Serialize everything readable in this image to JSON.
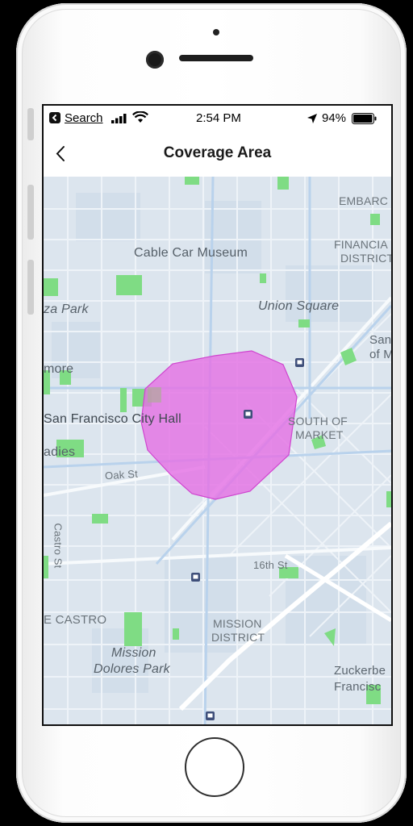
{
  "status_bar": {
    "back_app": "Search",
    "time": "2:54 PM",
    "battery": "94%",
    "icons": [
      "back-app-icon",
      "signal-icon",
      "wifi-icon",
      "location-arrow-icon",
      "battery-icon"
    ]
  },
  "nav": {
    "title": "Coverage Area",
    "back_icon": "chevron-left-icon"
  },
  "map": {
    "labels": {
      "embarcadero": "EMBARC",
      "financial_1": "FINANCIA",
      "financial_2": "DISTRICT",
      "cable_car": "Cable Car Museum",
      "plaza_park": "za Park",
      "union_square": "Union Square",
      "san_1": "San",
      "san_2": "of M",
      "fillmore": "more",
      "city_hall": "San Francisco City Hall",
      "south_1": "SOUTH OF",
      "south_2": "MARKET",
      "ladies": "adies",
      "oak_st": "Oak St",
      "castro_st": "Castro St",
      "st16": "16th St",
      "castro": "E CASTRO",
      "mission_1": "MISSION",
      "mission_2": "DISTRICT",
      "mdp_1": "Mission",
      "mdp_2": "Dolores Park",
      "zuck_1": "Zuckerbe",
      "zuck_2": "Francisc"
    },
    "coverage_color": "#e472e4",
    "park_color": "#7fdc84",
    "transit_icon": "transit-station-icon"
  }
}
